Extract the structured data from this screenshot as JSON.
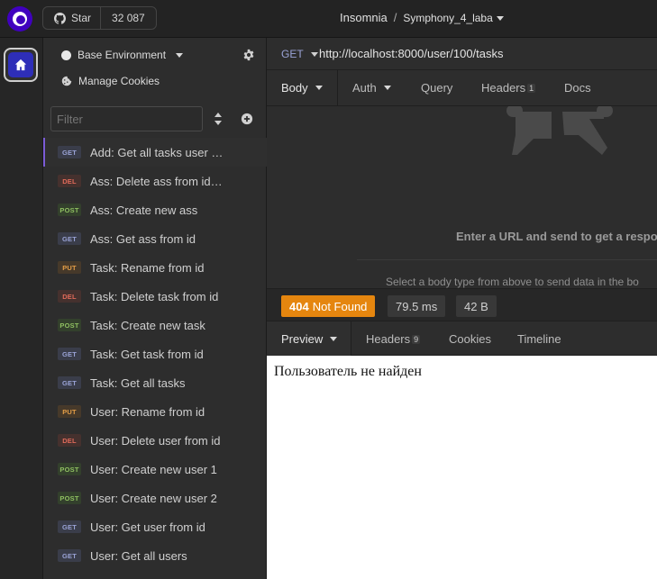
{
  "topbar": {
    "github_star_label": "Star",
    "github_star_count": "32 087",
    "app_name": "Insomnia",
    "separator": "/",
    "project_name": "Symphony_4_laba"
  },
  "sidebar": {
    "environment": "Base Environment",
    "manage_cookies": "Manage Cookies",
    "filter_placeholder": "Filter",
    "requests": [
      {
        "method": "GET",
        "name": "Add: Get all tasks user f…"
      },
      {
        "method": "DEL",
        "name": "Ass: Delete ass from id …"
      },
      {
        "method": "POST",
        "name": "Ass: Create new ass"
      },
      {
        "method": "GET",
        "name": "Ass: Get ass from id"
      },
      {
        "method": "PUT",
        "name": "Task: Rename from id"
      },
      {
        "method": "DEL",
        "name": "Task: Delete task from id"
      },
      {
        "method": "POST",
        "name": "Task: Create new task"
      },
      {
        "method": "GET",
        "name": "Task: Get task from id"
      },
      {
        "method": "GET",
        "name": "Task: Get all tasks"
      },
      {
        "method": "PUT",
        "name": "User: Rename from id"
      },
      {
        "method": "DEL",
        "name": "User: Delete user from id"
      },
      {
        "method": "POST",
        "name": "User: Create new user 1"
      },
      {
        "method": "POST",
        "name": "User: Create new user 2"
      },
      {
        "method": "GET",
        "name": "User: Get user from id"
      },
      {
        "method": "GET",
        "name": "User: Get all users"
      }
    ]
  },
  "request": {
    "method": "GET",
    "url": "http://localhost:8000/user/100/tasks",
    "tabs": {
      "body": "Body",
      "auth": "Auth",
      "query": "Query",
      "headers": "Headers",
      "headers_count": "1",
      "docs": "Docs"
    },
    "empty_hint": "Enter a URL and send to get a respons",
    "body_hint": "Select a body type from above to send data in the bo"
  },
  "response": {
    "status_code": "404",
    "status_text": "Not Found",
    "time": "79.5 ms",
    "size": "42 B",
    "tabs": {
      "preview": "Preview",
      "headers": "Headers",
      "headers_count": "9",
      "cookies": "Cookies",
      "timeline": "Timeline"
    },
    "preview_text": "Пользователь не найден"
  },
  "colors": {
    "accent": "#4000bf",
    "status_warning": "#e5860f",
    "get": "#9aa3d6",
    "delete": "#e06a5a",
    "post": "#8fbf61",
    "put": "#e39d47"
  },
  "icons": [
    "insomnia-logo-icon",
    "github-icon",
    "home-icon",
    "gear-icon",
    "cookie-icon",
    "sort-icon",
    "add-icon",
    "caret-down-icon"
  ]
}
